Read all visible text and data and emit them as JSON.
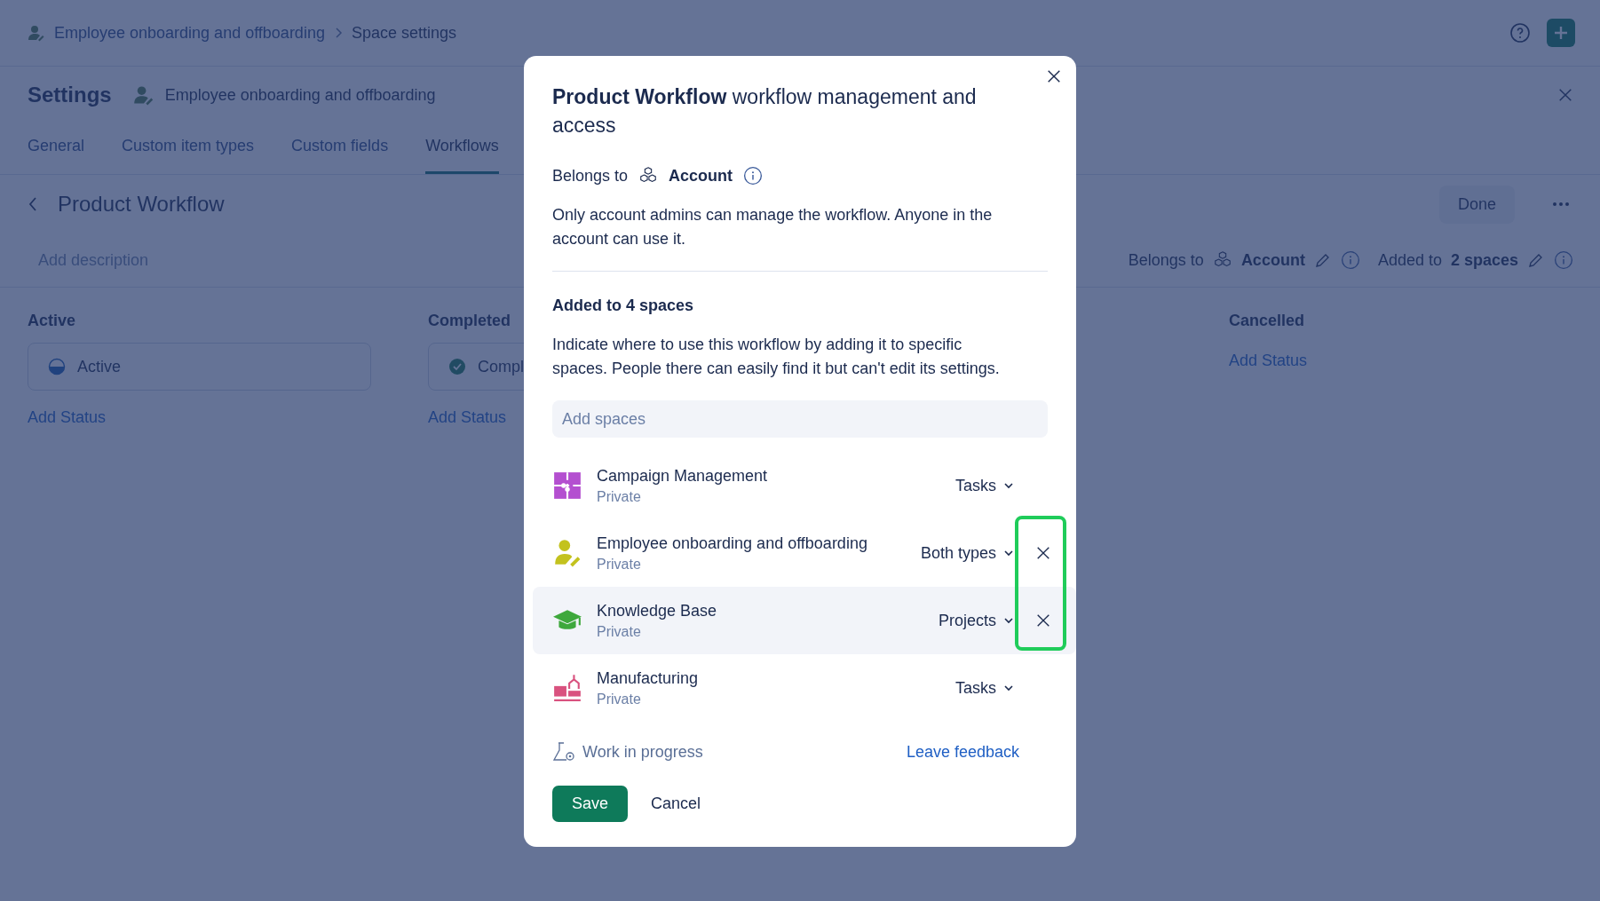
{
  "breadcrumb": [
    {
      "label": "Employee onboarding and offboarding",
      "current": false
    },
    {
      "label": "Space settings",
      "current": true
    }
  ],
  "header": {
    "title": "Settings",
    "space": "Employee onboarding and offboarding"
  },
  "tabs": [
    {
      "label": "General",
      "selected": false
    },
    {
      "label": "Custom item types",
      "selected": false
    },
    {
      "label": "Custom fields",
      "selected": false
    },
    {
      "label": "Workflows",
      "selected": true
    }
  ],
  "workflow": {
    "name": "Product Workflow",
    "description_placeholder": "Add description",
    "done": "Done",
    "belongs_label": "Belongs to",
    "belongs_value": "Account",
    "added_label": "Added to",
    "added_value": "2 spaces"
  },
  "columns": [
    {
      "title": "Active",
      "statuses": [
        {
          "label": "Active",
          "kind": "active"
        }
      ],
      "add": "Add Status"
    },
    {
      "title": "Completed",
      "statuses": [
        {
          "label": "Compl",
          "kind": "done"
        }
      ],
      "add": "Add Status"
    },
    {
      "title": "Cancelled",
      "add": "Add Status"
    }
  ],
  "modal": {
    "title": "**Product Workflow** workflow management and access",
    "belongs_label": "Belongs to",
    "belongs_value": "Account",
    "note": "Only account admins can manage the workflow. Anyone in the account can use it.",
    "section_title": "Added to 4 spaces",
    "section_text": "Indicate where to use this workflow by adding it to specific spaces. People there can easily find it but can't edit its settings.",
    "search": {
      "placeholder": "Add spaces"
    },
    "spaces": [
      {
        "name": "Campaign Management",
        "access": "Private",
        "type": "Tasks",
        "kind": "puzzle",
        "color": "#b44fd0",
        "removable": false,
        "highlighted": false
      },
      {
        "name": "Employee onboarding and offboarding",
        "access": "Private",
        "type": "Both types",
        "kind": "person",
        "color": "#c3c21e",
        "removable": true,
        "highlighted": false
      },
      {
        "name": "Knowledge Base",
        "access": "Private",
        "type": "Projects",
        "kind": "cap",
        "color": "#3ea83c",
        "removable": true,
        "highlighted": true
      },
      {
        "name": "Manufacturing",
        "access": "Private",
        "type": "Tasks",
        "kind": "factory",
        "color": "#d9527f",
        "removable": false,
        "highlighted": false
      }
    ],
    "status": "Work in progress",
    "feedback": "Leave feedback",
    "save": "Save",
    "cancel": "Cancel"
  }
}
